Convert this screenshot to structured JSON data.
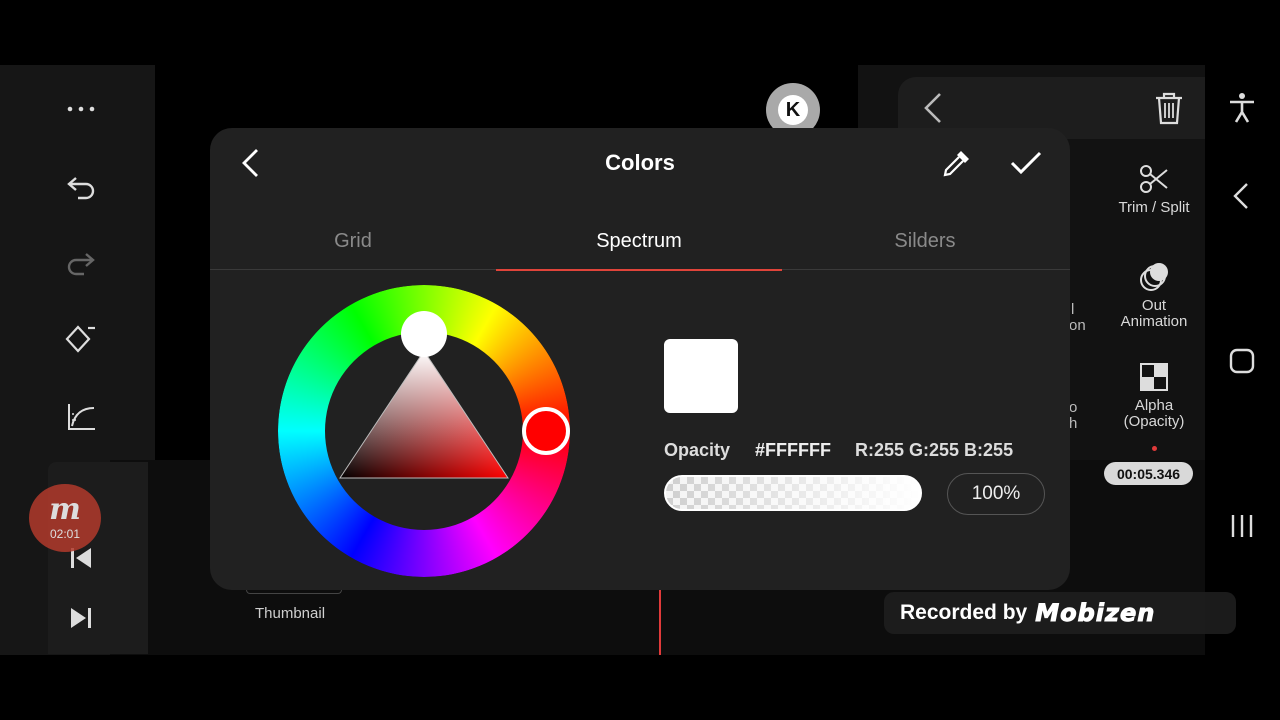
{
  "left_toolbar": {
    "icons": [
      "more-icon",
      "undo-icon",
      "redo-icon",
      "keyframe-icon",
      "graph-icon",
      "chevron-up-icon",
      "skip-start-icon",
      "skip-end-icon"
    ]
  },
  "mobizen_bubble": {
    "time": "02:01"
  },
  "timeline": {
    "thumbnail_label": "Thumbnail"
  },
  "right_panel": {
    "items": [
      {
        "label": "Trim / Split",
        "icon": "scissors-icon"
      },
      {
        "label": "Out\nAnimation",
        "icon": "out-animation-icon"
      },
      {
        "label": "Alpha\n(Opacity)",
        "icon": "alpha-icon"
      }
    ],
    "partial_labels": [
      "l",
      "on",
      "o",
      "h"
    ],
    "time_badge": "00:05.346"
  },
  "dialog": {
    "title": "Colors",
    "tabs": [
      {
        "label": "Grid",
        "active": false
      },
      {
        "label": "Spectrum",
        "active": true
      },
      {
        "label": "Silders",
        "active": false
      }
    ],
    "opacity_label": "Opacity",
    "hex": "#FFFFFF",
    "rgb": "R:255 G:255 B:255",
    "opacity_value": "100%",
    "opacity_fraction": 1.0,
    "selected_color": "#FFFFFF",
    "hue_color": "#FF0000"
  },
  "recorded": {
    "text": "Recorded by",
    "brand": "Mobizen"
  },
  "colors": {
    "accent": "#E0443A",
    "dialog_bg": "#212121"
  }
}
